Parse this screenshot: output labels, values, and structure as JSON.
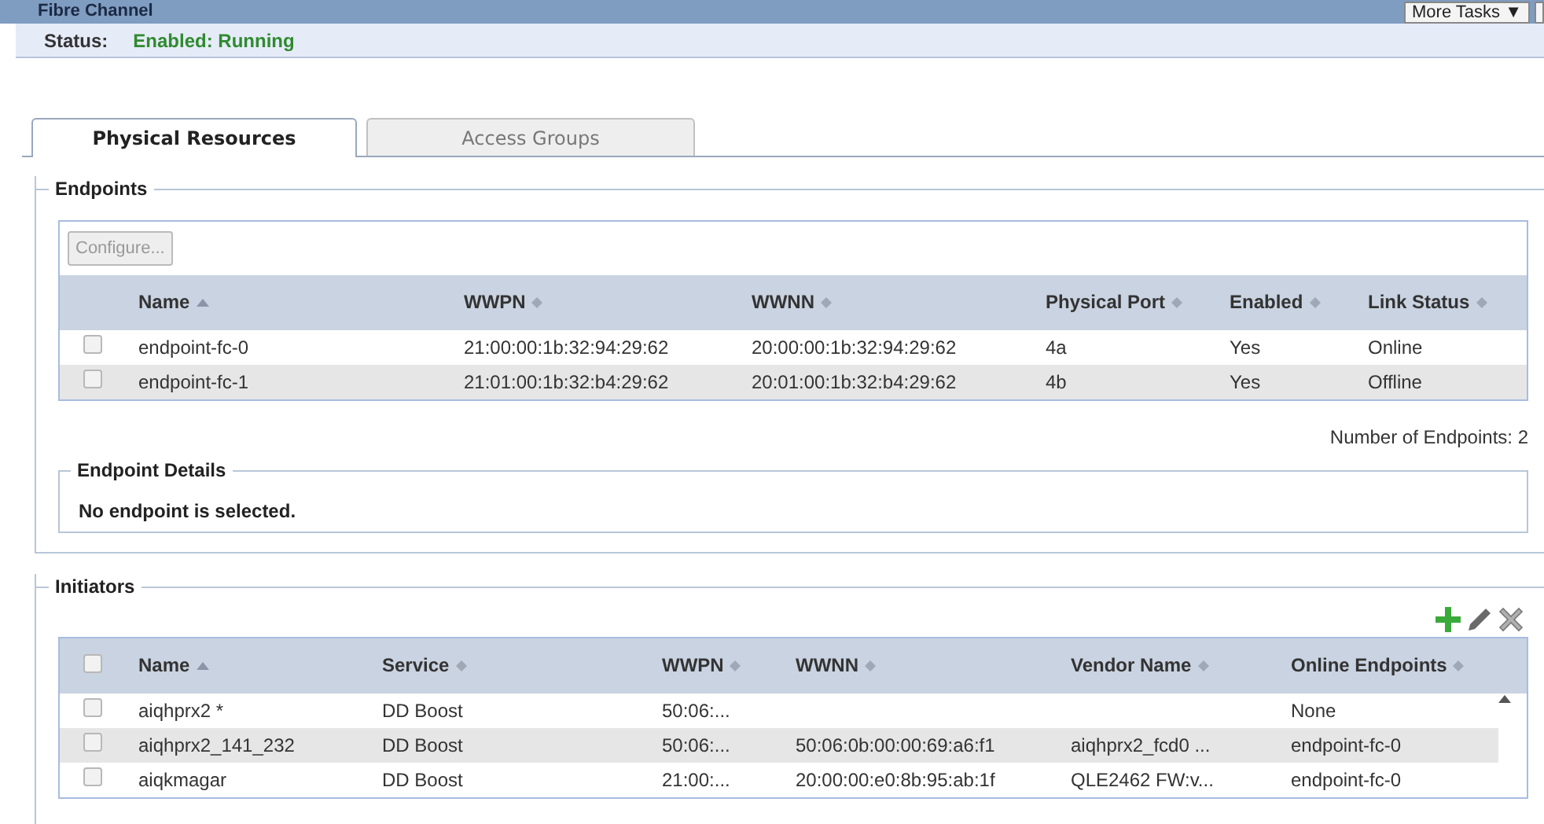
{
  "window": {
    "title": "Fibre Channel",
    "more_tasks": "More Tasks ▼"
  },
  "status": {
    "label": "Status:",
    "value": "Enabled: Running"
  },
  "tabs": [
    {
      "label": "Physical Resources",
      "selected": true
    },
    {
      "label": "Access Groups",
      "selected": false
    }
  ],
  "endpoints": {
    "legend": "Endpoints",
    "configure": "Configure...",
    "columns": [
      {
        "label": "Name",
        "sorted": true
      },
      {
        "label": "WWPN",
        "sorted": false
      },
      {
        "label": "WWNN",
        "sorted": false
      },
      {
        "label": "Physical Port",
        "sorted": false
      },
      {
        "label": "Enabled",
        "sorted": false
      },
      {
        "label": "Link Status",
        "sorted": false
      }
    ],
    "rows": [
      {
        "checked": false,
        "cells": [
          "endpoint-fc-0",
          "21:00:00:1b:32:94:29:62",
          "20:00:00:1b:32:94:29:62",
          "4a",
          "Yes",
          "Online"
        ]
      },
      {
        "checked": false,
        "cells": [
          "endpoint-fc-1",
          "21:01:00:1b:32:b4:29:62",
          "20:01:00:1b:32:b4:29:62",
          "4b",
          "Yes",
          "Offline"
        ]
      }
    ],
    "count": "Number of Endpoints: 2"
  },
  "endpoint_details": {
    "legend": "Endpoint Details",
    "message": "No endpoint is selected."
  },
  "initiators": {
    "legend": "Initiators",
    "all_checked": false,
    "columns": [
      {
        "label": "Name",
        "sorted": true
      },
      {
        "label": "Service",
        "sorted": false
      },
      {
        "label": "WWPN",
        "sorted": false
      },
      {
        "label": "WWNN",
        "sorted": false
      },
      {
        "label": "Vendor Name",
        "sorted": false
      },
      {
        "label": "Online Endpoints",
        "sorted": false
      }
    ],
    "rows": [
      {
        "checked": false,
        "cells": [
          "aiqhprx2 *",
          "DD Boost",
          "50:06:...",
          "",
          "",
          "None"
        ]
      },
      {
        "checked": false,
        "cells": [
          "aiqhprx2_141_232",
          "DD Boost",
          "50:06:...",
          "50:06:0b:00:00:69:a6:f1",
          "aiqhprx2_fcd0 ...",
          "endpoint-fc-0"
        ]
      },
      {
        "checked": false,
        "cells": [
          "aiqkmagar",
          "DD Boost",
          "21:00:...",
          "20:00:00:e0:8b:95:ab:1f",
          "QLE2462 FW:v...",
          "endpoint-fc-0"
        ]
      }
    ]
  }
}
